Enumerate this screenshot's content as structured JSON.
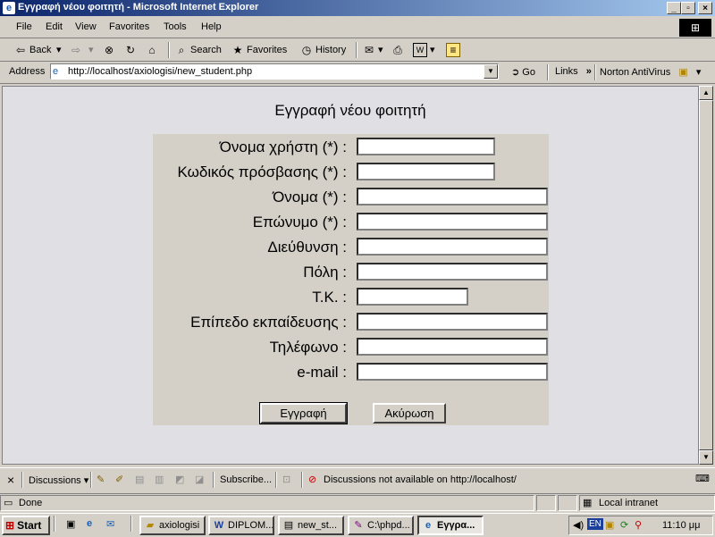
{
  "window": {
    "title": "Εγγραφή νέου φοιτητή - Microsoft Internet Explorer",
    "minimize": "_",
    "maximize": "▫",
    "close": "×"
  },
  "menu": [
    "File",
    "Edit",
    "View",
    "Favorites",
    "Tools",
    "Help"
  ],
  "toolbar": {
    "back": "Back",
    "search": "Search",
    "favorites": "Favorites",
    "history": "History"
  },
  "address": {
    "label": "Address",
    "url": "http://localhost/axiologisi/new_student.php",
    "go": "Go",
    "links": "Links",
    "chevron": "»",
    "norton": "Norton AntiVirus"
  },
  "page": {
    "title": "Εγγραφή νέου φοιτητή",
    "fields": [
      {
        "label": "Όνομα χρήστη (*) :",
        "value": ""
      },
      {
        "label": "Κωδικός πρόσβασης (*) :",
        "value": ""
      },
      {
        "label": "Όνομα (*) :",
        "value": ""
      },
      {
        "label": "Επώνυμο (*) :",
        "value": ""
      },
      {
        "label": "Διεύθυνση :",
        "value": ""
      },
      {
        "label": "Πόλη :",
        "value": ""
      },
      {
        "label": "Τ.Κ. :",
        "value": ""
      },
      {
        "label": "Επίπεδο εκπαίδευσης :",
        "value": ""
      },
      {
        "label": "Τηλέφωνο :",
        "value": ""
      },
      {
        "label": "e-mail :",
        "value": ""
      }
    ],
    "submit_label": "Εγγραφή",
    "cancel_label": "Ακύρωση"
  },
  "discussions": {
    "close": "×",
    "label": "Discussions",
    "subscribe": "Subscribe...",
    "status": "Discussions not available on http://localhost/"
  },
  "status": {
    "text": "Done",
    "zone": "Local intranet"
  },
  "taskbar": {
    "start": "Start",
    "tasks": [
      {
        "label": "axiologisi",
        "icon": "folder-icon"
      },
      {
        "label": "DIPLOM...",
        "icon": "word-icon"
      },
      {
        "label": "new_st...",
        "icon": "notepad-icon"
      },
      {
        "label": "C:\\phpd...",
        "icon": "editor-icon"
      },
      {
        "label": "Εγγρα...",
        "icon": "ie-icon"
      }
    ],
    "lang": "EN",
    "clock": "11:10 μμ"
  },
  "colors": {
    "titlebar_start": "#0a246a",
    "titlebar_end": "#a6caf0",
    "chrome": "#d4d0c8",
    "page_bg": "#e0dfe3"
  }
}
